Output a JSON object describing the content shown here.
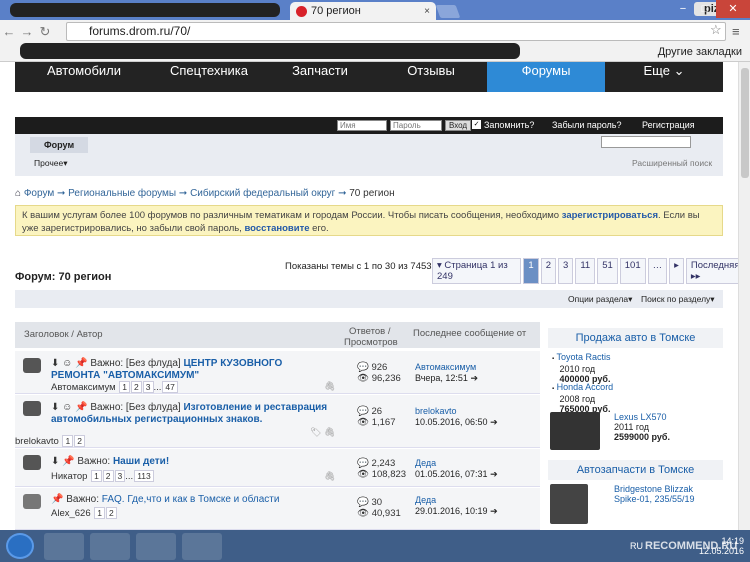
{
  "browser": {
    "tab_title": "70 регион",
    "tab_close": "×",
    "url": "forums.drom.ru/70/",
    "user": "pizik123",
    "win_min": "−",
    "win_max": "□",
    "win_close": "✕",
    "other_bookmarks": "Другие закладки"
  },
  "mainnav": [
    "Автомобили",
    "Спецтехника",
    "Запчасти",
    "Отзывы",
    "Форумы",
    "Еще ⌄"
  ],
  "login": {
    "name_placeholder": "Имя",
    "pass_placeholder": "Пароль",
    "enter": "Вход",
    "remember": "Запомнить?",
    "forgot": "Забыли пароль?",
    "register": "Регистрация"
  },
  "subbar": {
    "tab": "Форум",
    "more": "Прочее▾",
    "adv_search": "Расширенный поиск"
  },
  "breadcrumb": {
    "home_icon": "home-icon",
    "items": [
      "Форум",
      "Региональные форумы",
      "Сибирский федеральный округ",
      "70 регион"
    ]
  },
  "notice": {
    "text1": "К вашим услугам более 100 форумов по различным тематикам и городам России. Чтобы писать сообщения, необходимо ",
    "link1": "зарегистрироваться",
    "text2": ". Если вы уже зарегистрировались, но забыли свой пароль, ",
    "link2": "восстановите",
    "text3": " его."
  },
  "forum_title": "Форум: 70 регион",
  "pager": {
    "info": "Показаны темы с 1 по 30 из 7453",
    "label": "▾ Страница 1 из 249",
    "pages": [
      "1",
      "2",
      "3",
      "11",
      "51",
      "101",
      "…"
    ],
    "next": "▸",
    "last": "Последняя ▸▸"
  },
  "options": {
    "section": "Опции раздела▾",
    "search": "Поиск по разделу▾"
  },
  "thead": {
    "title": "Заголовок / Автор",
    "replies": "Ответов /",
    "views": "Просмотров",
    "last": "Последнее сообщение от"
  },
  "threads": [
    {
      "prefix": "Важно: [Без флуда] ",
      "title": "ЦЕНТР КУЗОВНОГО РЕМОНТА \"АВТОМАКСИМУМ\"",
      "starter": "Автомаксимум",
      "pages": [
        "1",
        "2",
        "3",
        "...",
        "47"
      ],
      "replies": "926",
      "views": "96,236",
      "last_user": "Автомаксимум",
      "last_time": "Вчера, 12:51"
    },
    {
      "prefix": "Важно: [Без флуда] ",
      "title": "Изготовление и реставрация автомобильных регистрационных знаков.",
      "starter": "brelokavto",
      "pages": [
        "1",
        "2"
      ],
      "replies": "26",
      "views": "1,167",
      "last_user": "brelokavto",
      "last_time": "10.05.2016, 06:50"
    },
    {
      "prefix": "Важно: ",
      "title": "Наши дети!",
      "starter": "Никатор",
      "pages": [
        "1",
        "2",
        "3",
        "...",
        "113"
      ],
      "replies": "2,243",
      "views": "108,823",
      "last_user": "Деда",
      "last_time": "01.05.2016, 07:31"
    },
    {
      "prefix": "Важно: ",
      "title": "FAQ. Где,что и как в Томске и области",
      "starter": "Alex_626",
      "pages": [
        "1",
        "2"
      ],
      "replies": "30",
      "views": "40,931",
      "last_user": "Деда",
      "last_time": "29.01.2016, 10:19"
    }
  ],
  "sidebar": {
    "sale_title": "Продажа авто в Томске",
    "cars": [
      {
        "name": "Toyota Ractis",
        "year": "2010 год",
        "price": "400000 руб."
      },
      {
        "name": "Honda Accord",
        "year": "2008 год",
        "price": "765000 руб."
      },
      {
        "name": "Lexus LX570",
        "year": "2011 год",
        "price": "2599000 руб."
      }
    ],
    "parts_title": "Автозапчасти в Томске",
    "part": "Bridgestone Blizzak Spike-01, 235/55/19"
  },
  "taskbar": {
    "lang": "RU",
    "time": "14:19",
    "date": "12.05.2016",
    "watermark": "RECOMMEND.RU"
  }
}
